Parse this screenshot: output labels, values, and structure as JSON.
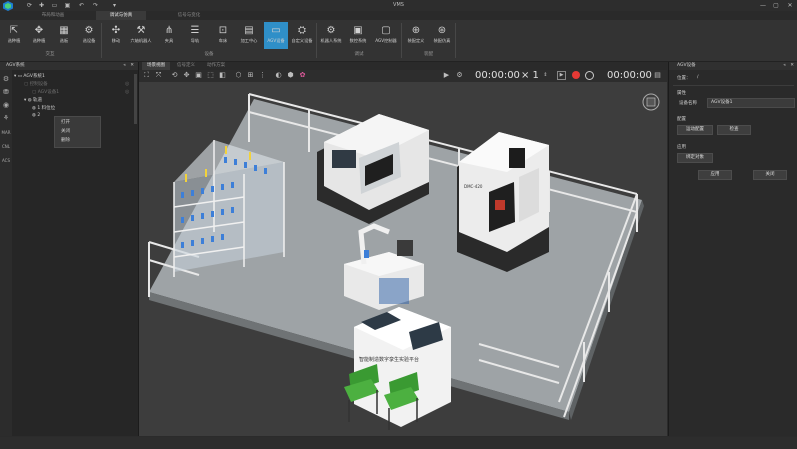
{
  "window": {
    "title": "VMS",
    "minimize": "—",
    "maximize": "▢",
    "close": "✕"
  },
  "ribbon": {
    "tabs": [
      "布局和动画",
      "调试与仿真",
      "信号与变化"
    ],
    "active_tab": 1,
    "buttons": [
      {
        "label": "选种植",
        "icon": "select-icon"
      },
      {
        "label": "选种植",
        "icon": "pick-icon"
      },
      {
        "label": "选板",
        "icon": "board-icon"
      },
      {
        "label": "选设备",
        "icon": "device-icon"
      },
      {
        "label": "移动",
        "icon": "move-icon"
      },
      {
        "label": "六轴机器人",
        "icon": "robot-icon"
      },
      {
        "label": "夹具",
        "icon": "gripper-icon"
      },
      {
        "label": "导轨",
        "icon": "rail-icon"
      },
      {
        "label": "车床",
        "icon": "lathe-icon"
      },
      {
        "label": "加工中心",
        "icon": "machining-center-icon"
      },
      {
        "label": "AGV设备",
        "icon": "agv-icon"
      },
      {
        "label": "自定义设备",
        "icon": "custom-device-icon"
      },
      {
        "label": "机器人系统",
        "icon": "robot-system-icon"
      },
      {
        "label": "数控系统",
        "icon": "cnc-system-icon"
      },
      {
        "label": "AGV控制器",
        "icon": "agv-controller-icon"
      },
      {
        "label": "装配定义",
        "icon": "assembly-define-icon"
      },
      {
        "label": "装配仿真",
        "icon": "assembly-sim-icon"
      }
    ],
    "groups": [
      "交互",
      "设备",
      "调试",
      "装配"
    ]
  },
  "left_panel": {
    "title": "AGV系统",
    "tree": [
      {
        "text": "AGV系统1",
        "dim": false
      },
      {
        "text": "控制设备",
        "dim": true
      },
      {
        "text": "AGV设备1",
        "dim": true
      },
      {
        "text": "轨道",
        "dim": false
      },
      {
        "text": "1  料位位",
        "dim": false
      },
      {
        "text": "2",
        "dim": false
      }
    ],
    "context_menu": [
      "打开",
      "关闭",
      "删除"
    ],
    "side_labels": [
      "MAR",
      "CNL",
      "ACS"
    ]
  },
  "viewport": {
    "tabs": [
      "场景视图",
      "信号定义",
      "动作方案"
    ],
    "active_tab": 0,
    "timer_left": "00:00:00",
    "speed": "× 1",
    "timer_right": "00:00:00",
    "lathe_brand": "",
    "mc_label": "DMC-420",
    "console_text": "智能制造数字孪生实验平台"
  },
  "right_panel": {
    "title": "AGV设备",
    "position_label": "位置：",
    "position_value": "/",
    "section_property": "属性",
    "name_label": "设备名称",
    "name_value": "AGV设备1",
    "section_config": "配置",
    "motion_config": "运动配置",
    "check": "检查",
    "section_apply": "应用",
    "bind_object": "绑定对象",
    "apply": "应用",
    "close": "关闭"
  },
  "colors": {
    "accent": "#2f8fc8",
    "record": "#e53935"
  }
}
